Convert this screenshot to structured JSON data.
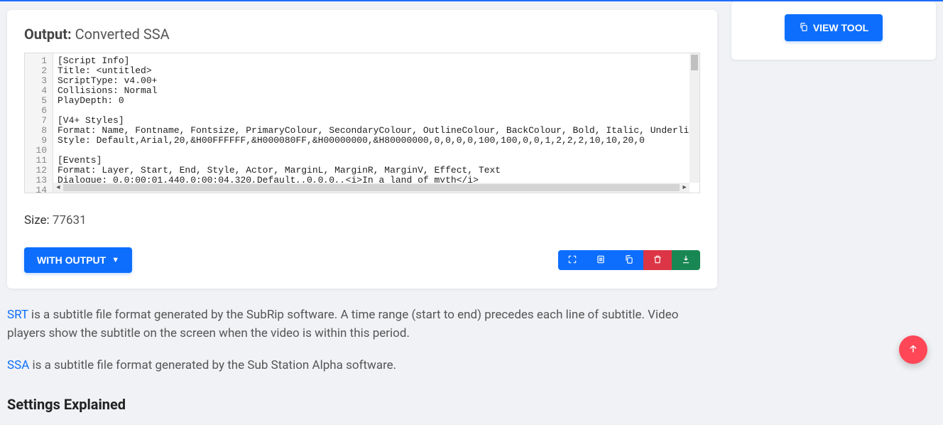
{
  "output": {
    "title_prefix": "Output:",
    "title_suffix": "Converted SSA",
    "lines": [
      "[Script Info]",
      "Title: <untitled>",
      "ScriptType: v4.00+",
      "Collisions: Normal",
      "PlayDepth: 0",
      "",
      "[V4+ Styles]",
      "Format: Name, Fontname, Fontsize, PrimaryColour, SecondaryColour, OutlineColour, BackColour, Bold, Italic, Underline, StrikeOut, Sca",
      "Style: Default,Arial,20,&H00FFFFFF,&H000080FF,&H00000000,&H80000000,0,0,0,0,100,100,0,0,1,2,2,2,10,10,20,0",
      "",
      "[Events]",
      "Format: Layer, Start, End, Style, Actor, MarginL, MarginR, MarginV, Effect, Text",
      "Dialogue: 0,0:00:01.440,0:00:04.320,Default,,0,0,0,,<i>In a land of myth</i>",
      ""
    ],
    "line_numbers": [
      "1",
      "2",
      "3",
      "4",
      "5",
      "6",
      "7",
      "8",
      "9",
      "10",
      "11",
      "12",
      "13",
      "14"
    ],
    "size_label": "Size:",
    "size_value": "77631",
    "with_output_label": "WITH OUTPUT"
  },
  "description": {
    "srt_link": "SRT",
    "srt_text": " is a subtitle file format generated by the SubRip software. A time range (start to end) precedes each line of subtitle. Video players show the subtitle on the screen when the video is within this period.",
    "ssa_link": "SSA",
    "ssa_text": " is a subtitle file format generated by the Sub Station Alpha software."
  },
  "section_heading": "Settings Explained",
  "sidebar": {
    "view_tool_label": "VIEW TOOL"
  }
}
